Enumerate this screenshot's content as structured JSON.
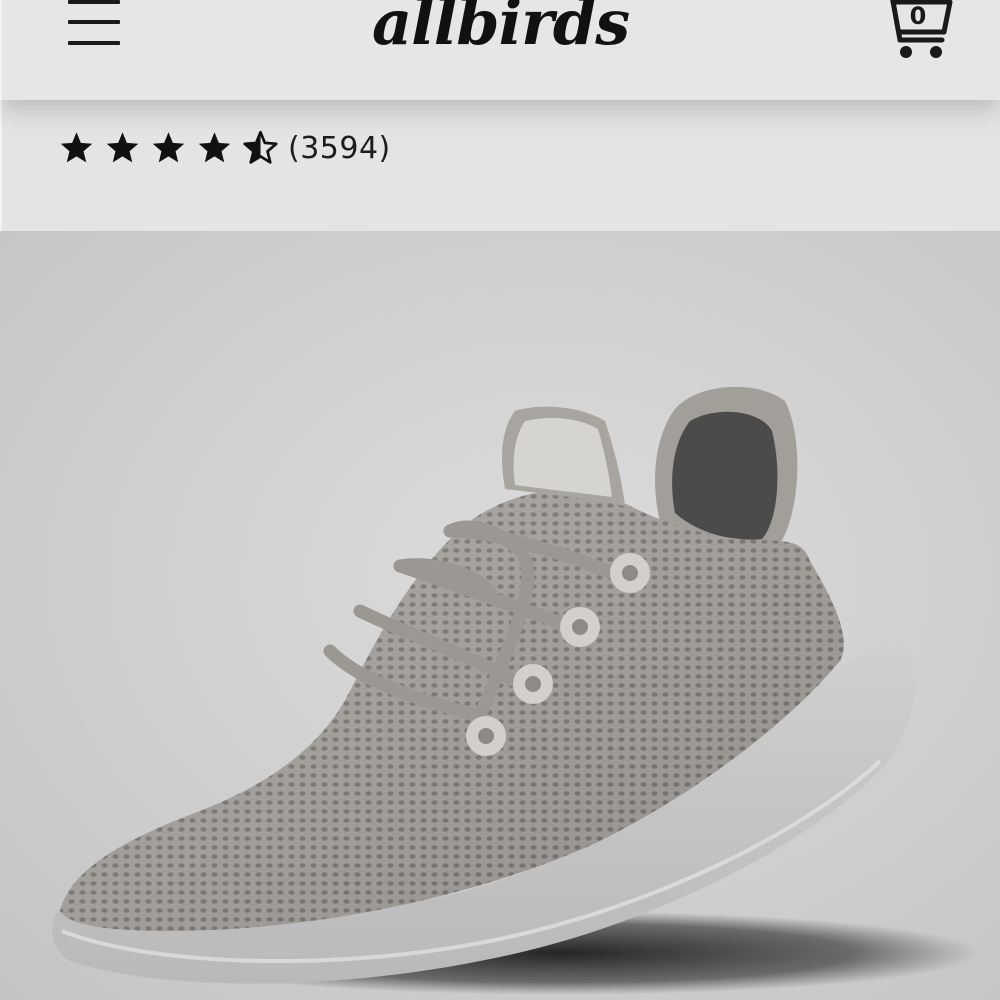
{
  "header": {
    "menu_icon": "hamburger-menu-icon",
    "logo_text": "allbirds",
    "cart_icon": "shopping-cart-icon",
    "cart_count": "0"
  },
  "rating": {
    "value": 4.5,
    "max": 5,
    "review_count": "(3594)"
  },
  "product": {
    "image_description_icon": "sneaker-image",
    "colors": {
      "upper": "#a39f9b",
      "sole": "#c9c9c9",
      "lining": "#4a4a4a",
      "background": "#d3d3d3"
    }
  }
}
